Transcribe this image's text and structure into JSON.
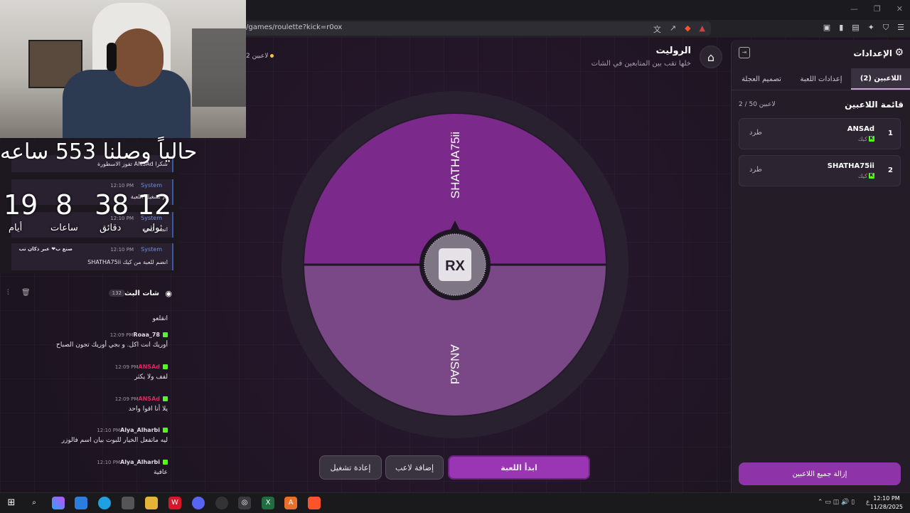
{
  "browser": {
    "url": "/games/roulette?kick=r0ox"
  },
  "header": {
    "title": "الروليت",
    "subtitle": "خلها تقب بين المتابعين في الشات",
    "player_count": "2 لاعبين"
  },
  "wheel": {
    "segments": [
      {
        "name": "SHATHA75ii",
        "color": "#7b2a8c"
      },
      {
        "name": "ANSAd",
        "color": "#7a4787"
      }
    ],
    "center_logo": "RX"
  },
  "buttons": {
    "start": "ابدأ اللعبة",
    "add_player": "إضافة لاعب",
    "replay": "إعادة تشغيل"
  },
  "settings": {
    "title": "الإعدادات",
    "tabs": [
      "اللاعبين (2)",
      "إعدادات اللعبة",
      "تصميم العجلة"
    ],
    "list_title": "قائمة اللاعبين",
    "list_count": "2 / 50 لاعبين",
    "players": [
      {
        "rank": "1",
        "name": "ANSAd",
        "platform": "كيك",
        "kick_label": "طرد"
      },
      {
        "rank": "2",
        "name": "SHATHA75ii",
        "platform": "كيك",
        "kick_label": "طرد"
      }
    ],
    "remove_all": "إزالة جميع اللاعبين"
  },
  "overlay": {
    "timer_title": "حالياً وصلنا 553 ساعه",
    "timer": [
      {
        "value": "19",
        "label": "أيام"
      },
      {
        "value": "8",
        "label": "ساعات"
      },
      {
        "value": "38",
        "label": "دقائق"
      },
      {
        "value": "12",
        "label": "ثواني"
      }
    ]
  },
  "system_chat": [
    {
      "sender": "System",
      "time": "12:10 PM",
      "text": "تفوز الاسطورة ANSAd شكرا"
    },
    {
      "sender": "System",
      "time": "12:10 PM",
      "text": "تم تشغيل اللعبة"
    },
    {
      "sender": "System",
      "time": "12:10 PM",
      "text": "انضم للعبة"
    },
    {
      "sender": "System",
      "time": "12:10 PM",
      "text": "SHATHA75ii انضم للعبة من كيك",
      "extra": "صنع ب❤ عبر ذكان تب"
    }
  ],
  "chat": {
    "title": "شات البث",
    "count": "132",
    "messages": [
      {
        "user": "",
        "time": "",
        "text": "انقلعو"
      },
      {
        "user": "Roaa_78",
        "time": "12:09 PM",
        "text": "أوريك انت اكل. و بجي أوريك تجون الصباح",
        "color": "#e0d8e8"
      },
      {
        "user": "ANSAd",
        "time": "12:09 PM",
        "text": "لفف ولا يكثر",
        "color": "#e0245e"
      },
      {
        "user": "ANSAd",
        "time": "12:09 PM",
        "text": "يلا أنا اقوا واحد",
        "color": "#e0245e"
      },
      {
        "user": "Alya_Alharbi",
        "time": "12:10 PM",
        "text": "ليه ماتفعل الخيار للبوت بيان اسم فالوزر",
        "color": "#e0d8e8"
      },
      {
        "user": "Alya_Alharbi",
        "time": "12:10 PM",
        "text": "عافية",
        "color": "#e0d8e8"
      }
    ]
  },
  "taskbar": {
    "time": "12:10 PM",
    "date": "11/28/2025",
    "lang": "ع"
  }
}
